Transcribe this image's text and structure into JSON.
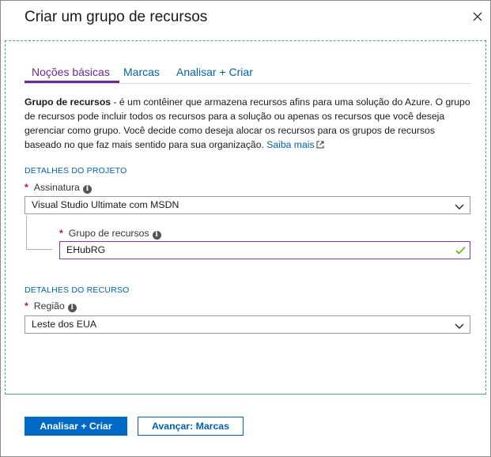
{
  "dialog": {
    "title": "Criar um grupo de recursos"
  },
  "tabs": [
    {
      "label": "Noções básicas",
      "active": true
    },
    {
      "label": "Marcas",
      "active": false
    },
    {
      "label": "Analisar + Criar",
      "active": false
    }
  ],
  "description": {
    "bold": "Grupo de recursos",
    "text": " - é um contêiner que armazena recursos afins para uma solução do Azure. O grupo de recursos pode incluir todos os recursos para a solução ou apenas os recursos que você deseja gerenciar como grupo. Você decide como deseja alocar os recursos para os grupos de recursos baseado no que faz mais sentido para sua organização. ",
    "link": "Saiba mais"
  },
  "project": {
    "heading": "DETALHES DO PROJETO",
    "subscription_label": "Assinatura",
    "subscription_value": "Visual Studio Ultimate com MSDN",
    "resource_group_label": "Grupo de recursos",
    "resource_group_value": "EHubRG"
  },
  "resource": {
    "heading": "DETALHES DO RECURSO",
    "region_label": "Região",
    "region_value": "Leste dos EUA"
  },
  "buttons": {
    "primary": "Analisar + Criar",
    "secondary": "Avançar: Marcas"
  },
  "colors": {
    "accent": "#0068c6",
    "tab_active": "#6b2a8d",
    "valid": "#5db300",
    "required": "#c8102e"
  }
}
